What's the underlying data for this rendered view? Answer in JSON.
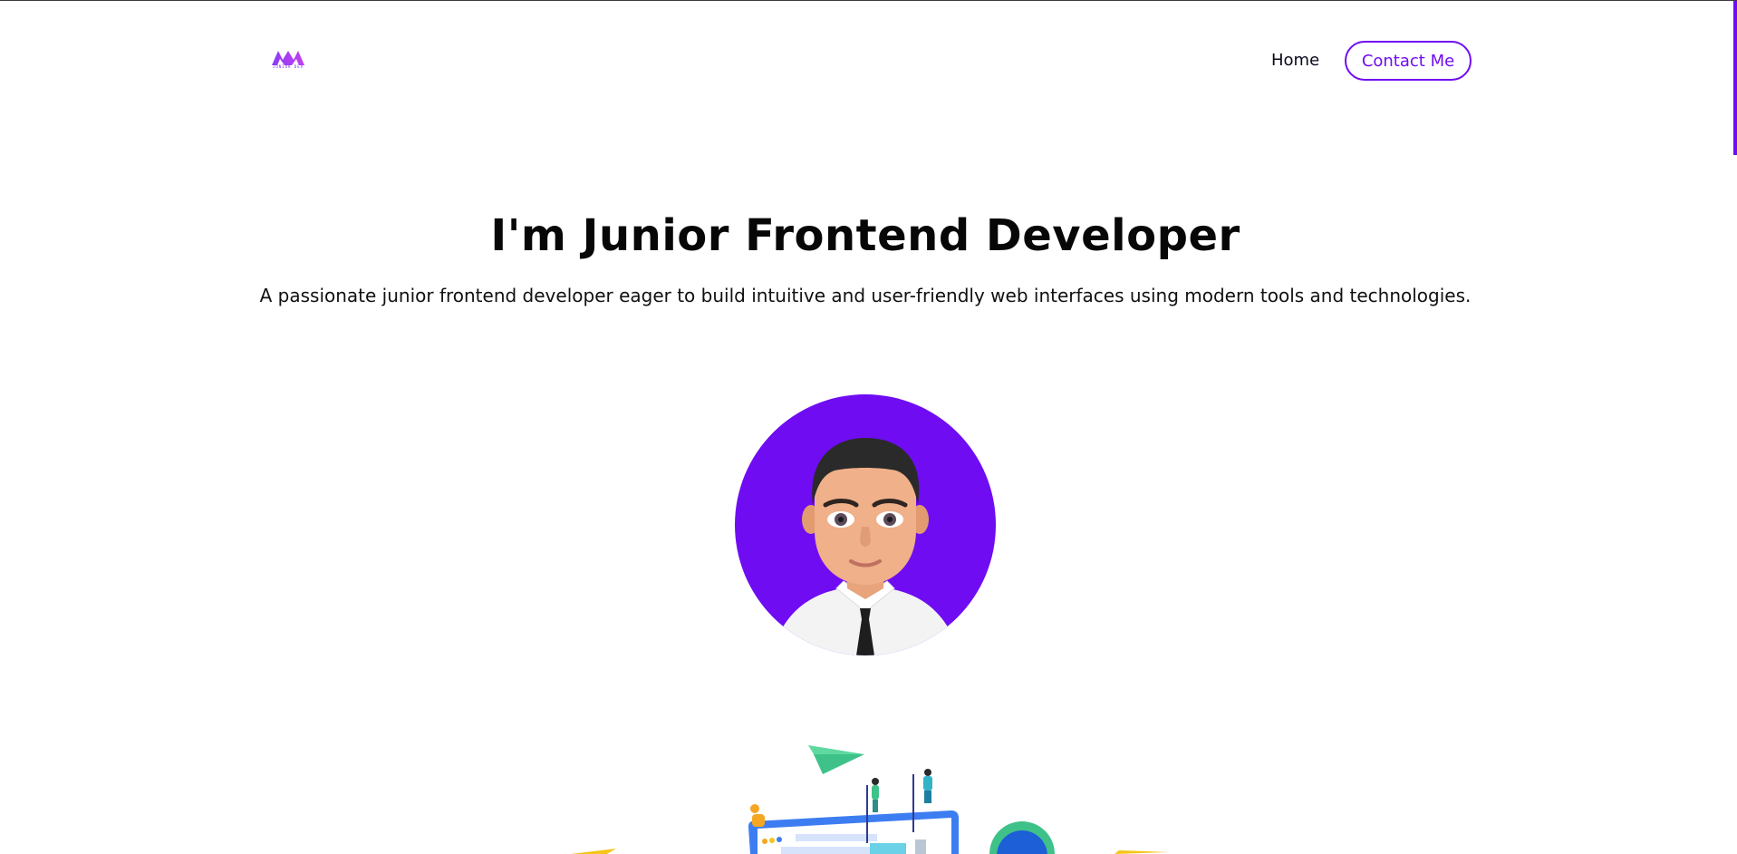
{
  "header": {
    "logo_text": "JUNIOR DEV",
    "nav": {
      "home_label": "Home",
      "contact_label": "Contact Me"
    }
  },
  "hero": {
    "title": "I'm Junior Frontend Developer",
    "subtitle": "A passionate junior frontend developer eager to build intuitive and user-friendly web interfaces using modern tools and technologies."
  },
  "colors": {
    "accent": "#6f0cf2",
    "text": "#070707",
    "background": "#ffffff"
  },
  "icons": {
    "logo": "m-logo-icon",
    "avatar": "avatar-image",
    "illustration": "team-building-website-illustration"
  }
}
